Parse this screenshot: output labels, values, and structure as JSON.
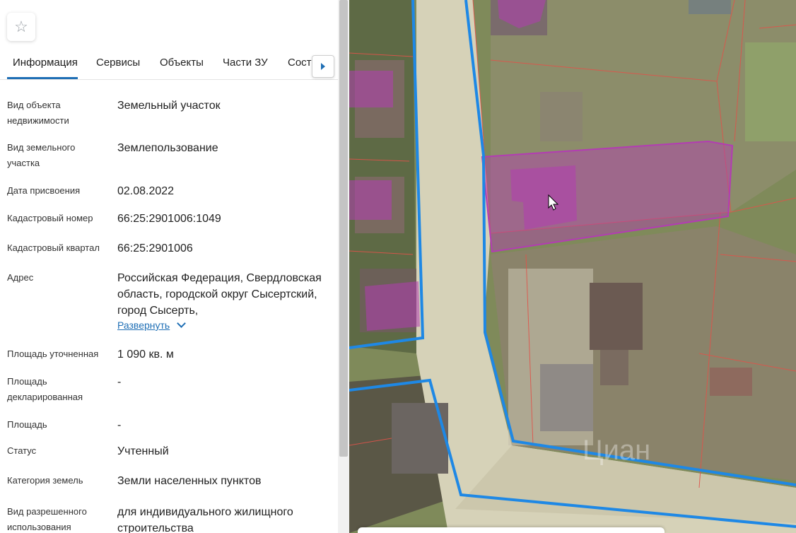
{
  "favorite": {
    "icon": "star-icon"
  },
  "tabs": [
    {
      "label": "Информация",
      "active": true
    },
    {
      "label": "Сервисы"
    },
    {
      "label": "Объекты"
    },
    {
      "label": "Части ЗУ"
    },
    {
      "label": "Соста"
    }
  ],
  "tabs_next": {
    "icon": "chevron-right-icon"
  },
  "info": {
    "object_type": {
      "label": "Вид объекта недвижимости",
      "value": "Земельный участок"
    },
    "land_type": {
      "label": "Вид земельного участка",
      "value": "Землепользование"
    },
    "assign_date": {
      "label": "Дата присвоения",
      "value": "02.08.2022"
    },
    "cadastral_number": {
      "label": "Кадастровый номер",
      "value": "66:25:2901006:1049"
    },
    "cadastral_quarter": {
      "label": "Кадастровый квартал",
      "value": "66:25:2901006"
    },
    "address": {
      "label": "Адрес",
      "value": "Российская Федерация, Свердловская область, городской округ Сысертский, город Сысерть,",
      "expand": "Развернуть"
    },
    "area_specified": {
      "label": "Площадь уточненная",
      "value": "1 090 кв. м"
    },
    "area_declared": {
      "label": "Площадь декларированная",
      "value": "-"
    },
    "area": {
      "label": "Площадь",
      "value": "-"
    },
    "status": {
      "label": "Статус",
      "value": "Учтенный"
    },
    "land_category": {
      "label": "Категория земель",
      "value": "Земли населенных пунктов"
    },
    "permitted_use": {
      "label": "Вид разрешенного использования",
      "value": "для индивидуального жилищного строительства"
    }
  },
  "map": {
    "watermark": "Циан",
    "highlight_color": "#b33cb3",
    "boundary_color": "#1e88e5",
    "parcel_line_color": "#e0534a"
  }
}
